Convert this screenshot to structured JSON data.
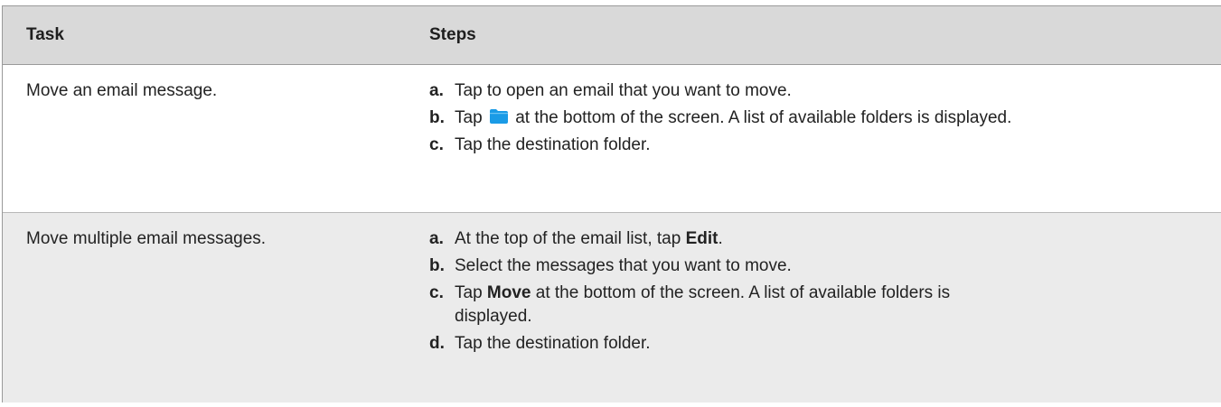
{
  "table": {
    "headers": {
      "task": "Task",
      "steps": "Steps"
    },
    "rows": [
      {
        "task": "Move an email message.",
        "steps": [
          {
            "marker": "a.",
            "text": "Tap to open an email that you want to move."
          },
          {
            "marker": "b.",
            "before": "Tap",
            "icon": "folder-icon",
            "after": "at the bottom of the screen. A list of available folders is displayed."
          },
          {
            "marker": "c.",
            "text": "Tap the destination folder."
          }
        ]
      },
      {
        "task": "Move multiple email messages.",
        "steps": [
          {
            "marker": "a.",
            "before": "At the top of the email list, tap ",
            "bold": "Edit",
            "after": "."
          },
          {
            "marker": "b.",
            "text": "Select the messages that you want to move."
          },
          {
            "marker": "c.",
            "before": "Tap ",
            "bold": "Move",
            "after": " at the bottom of the screen. A list of available folders is displayed."
          },
          {
            "marker": "d.",
            "text": "Tap the destination folder."
          }
        ]
      }
    ]
  },
  "colors": {
    "header_bg": "#d9d9d9",
    "alt_row_bg": "#ebebeb",
    "folder_icon": "#1a9be6"
  }
}
